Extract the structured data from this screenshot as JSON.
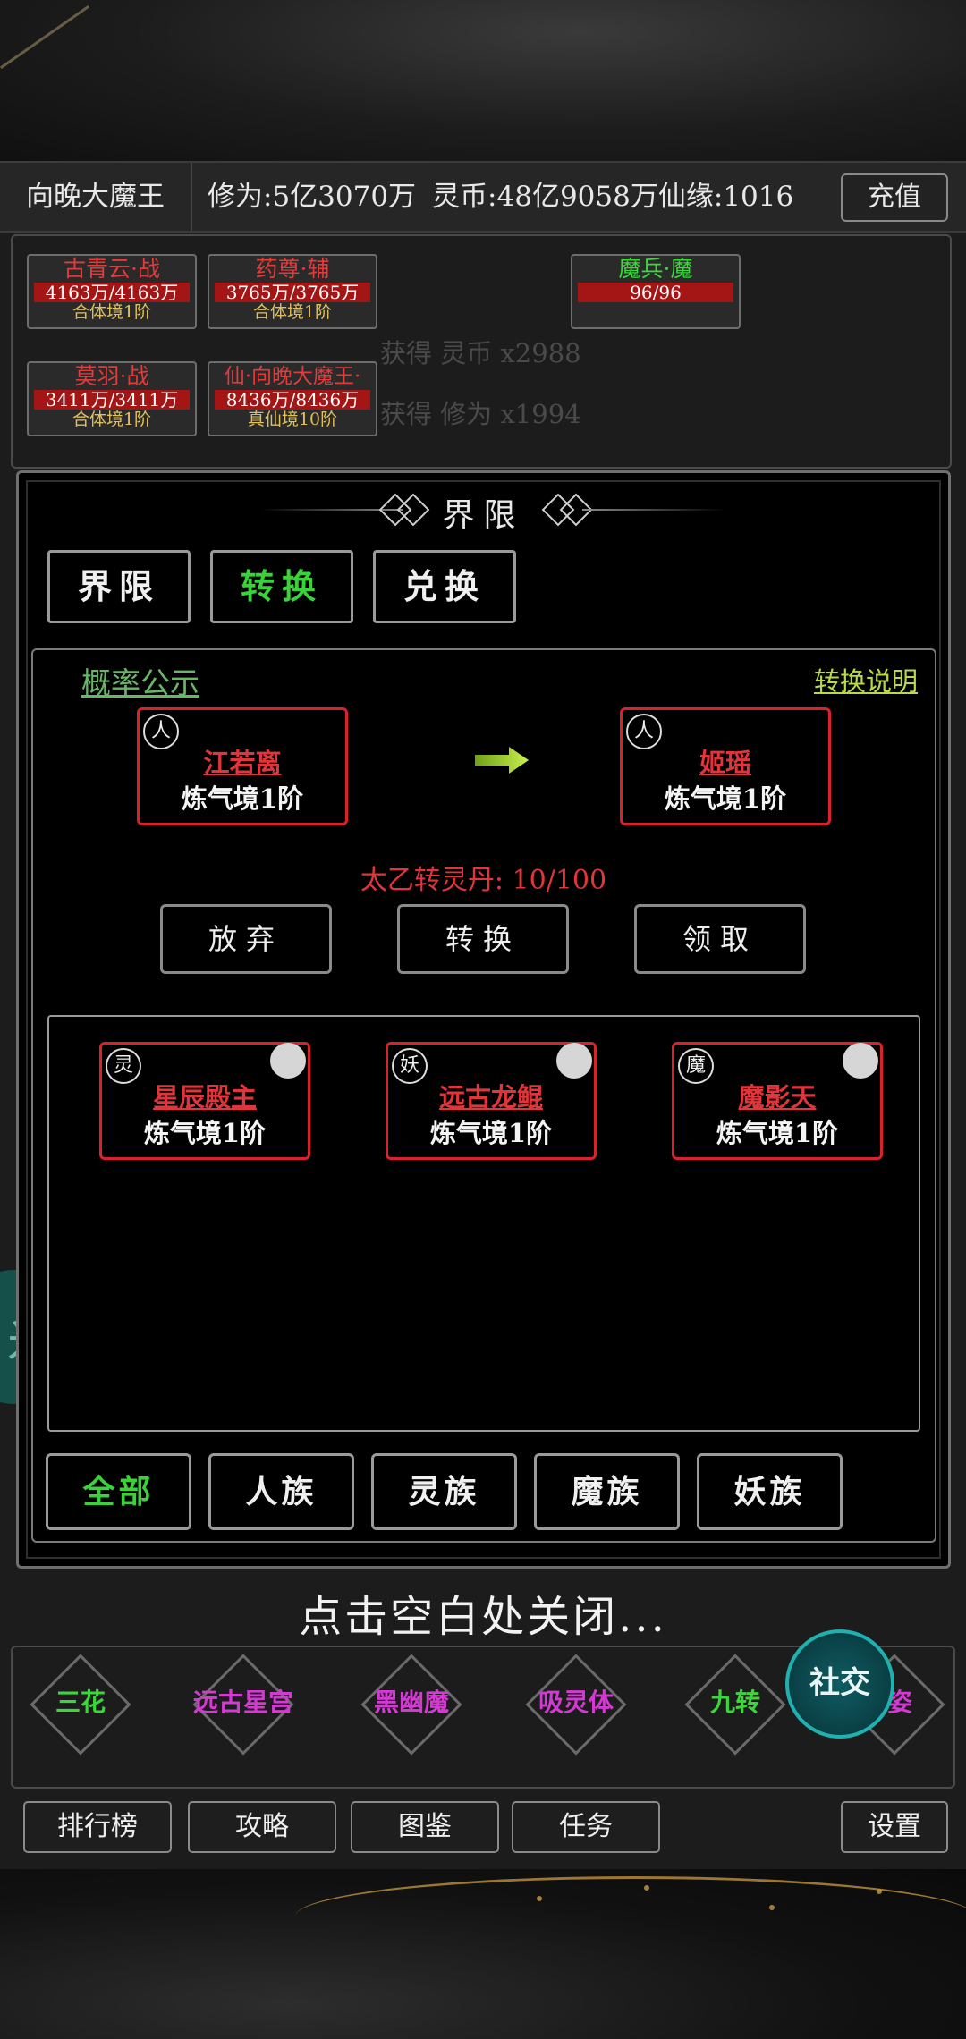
{
  "topbar": {
    "player_name": "向晚大魔王",
    "cultivation": "修为:5亿3070万",
    "coins": "灵币:48亿9058万",
    "fate": "仙缘:1016",
    "recharge_label": "充值"
  },
  "team": {
    "cards": [
      {
        "title": "古青云·战",
        "hp": "4163万/4163万",
        "level": "合体境1阶"
      },
      {
        "title": "药尊·辅",
        "hp": "3765万/3765万",
        "level": "合体境1阶"
      },
      {
        "title": "魔兵·魔",
        "hp": "96/96",
        "level": ""
      },
      {
        "title": "莫羽·战",
        "hp": "3411万/3411万",
        "level": "合体境1阶"
      },
      {
        "title": "仙·向晚大魔王·",
        "hp": "8436万/8436万",
        "level": "真仙境10阶"
      }
    ],
    "loot": [
      "获得 灵币 x2988",
      "获得 修为 x1994"
    ]
  },
  "dialog": {
    "title": "界限",
    "tabs": [
      {
        "label": "界限",
        "active": false
      },
      {
        "label": "转换",
        "active": true
      },
      {
        "label": "兑换",
        "active": false
      }
    ],
    "probability_link": "概率公示",
    "convert_desc_link": "转换说明",
    "source_hero": {
      "race": "人",
      "name": "江若离",
      "level": "炼气境1阶"
    },
    "target_hero": {
      "race": "人",
      "name": "姬瑶",
      "level": "炼气境1阶"
    },
    "pill_count": "太乙转灵丹: 10/100",
    "actions": {
      "abandon": "放弃",
      "convert": "转换",
      "claim": "领取"
    },
    "candidates": [
      {
        "race": "灵",
        "name": "星辰殿主",
        "level": "炼气境1阶"
      },
      {
        "race": "妖",
        "name": "远古龙鲲",
        "level": "炼气境1阶"
      },
      {
        "race": "魔",
        "name": "魔影天",
        "level": "炼气境1阶"
      }
    ],
    "filters": [
      {
        "label": "全部",
        "active": true
      },
      {
        "label": "人族",
        "active": false
      },
      {
        "label": "灵族",
        "active": false
      },
      {
        "label": "魔族",
        "active": false
      },
      {
        "label": "妖族",
        "active": false
      }
    ]
  },
  "close_hint": "点击空白处关闭...",
  "skills": [
    {
      "label": "三花",
      "color": "#3ad63a"
    },
    {
      "label": "远古星宫",
      "color": "#d23ad2"
    },
    {
      "label": "黑幽魔",
      "color": "#d23ad2"
    },
    {
      "label": "吸灵体",
      "color": "#d23ad2"
    },
    {
      "label": "九转",
      "color": "#3ad63a"
    },
    {
      "label": "姿",
      "color": "#d23ad2"
    }
  ],
  "social_label": "社交",
  "menu": {
    "ranking": "排行榜",
    "guide": "攻略",
    "atlas": "图鉴",
    "tasks": "任务",
    "settings": "设置"
  }
}
